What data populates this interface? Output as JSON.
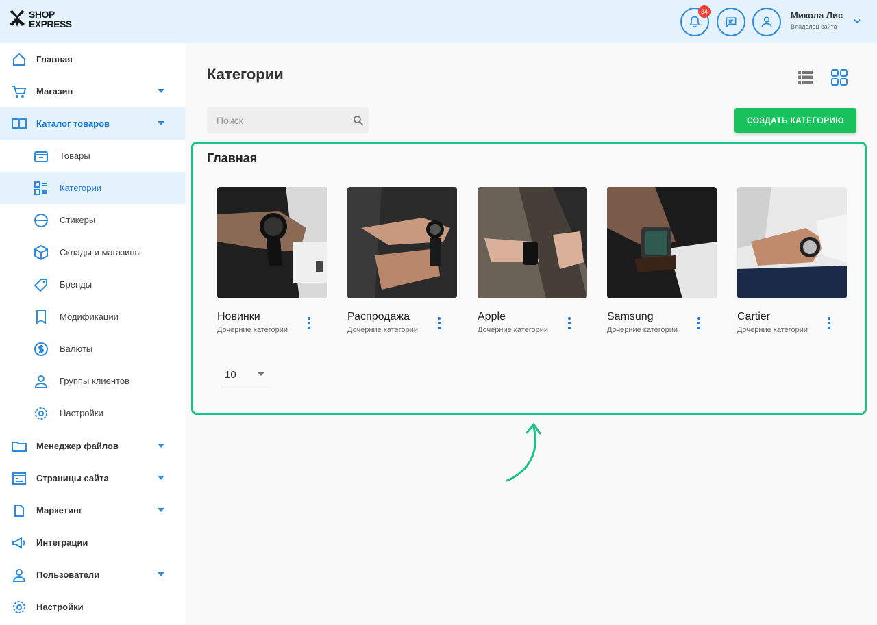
{
  "header": {
    "logo_line1": "SHOP",
    "logo_line2": "EXPRESS",
    "notifications_count": "34",
    "user_name": "Микола Лис",
    "user_role": "Владелец сайта"
  },
  "sidebar": {
    "items": [
      {
        "label": "Главная",
        "icon": "home-icon"
      },
      {
        "label": "Магазин",
        "icon": "cart-icon"
      },
      {
        "label": "Каталог товаров",
        "icon": "book-icon"
      },
      {
        "label": "Товары",
        "icon": "box-icon"
      },
      {
        "label": "Категории",
        "icon": "categories-icon"
      },
      {
        "label": "Стикеры",
        "icon": "sticker-icon"
      },
      {
        "label": "Склады и магазины",
        "icon": "warehouse-icon"
      },
      {
        "label": "Бренды",
        "icon": "tag-icon"
      },
      {
        "label": "Модификации",
        "icon": "bookmark-icon"
      },
      {
        "label": "Валюты",
        "icon": "dollar-icon"
      },
      {
        "label": "Группы клиентов",
        "icon": "users-icon"
      },
      {
        "label": "Настройки",
        "icon": "gear-icon"
      },
      {
        "label": "Менеджер файлов",
        "icon": "folder-icon"
      },
      {
        "label": "Страницы сайта",
        "icon": "pages-icon"
      },
      {
        "label": "Маркетинг",
        "icon": "marketing-icon"
      },
      {
        "label": "Интеграции",
        "icon": "megaphone-icon"
      },
      {
        "label": "Пользователи",
        "icon": "user-icon"
      },
      {
        "label": "Настройки",
        "icon": "gear-icon"
      }
    ]
  },
  "main": {
    "title": "Категории",
    "search_placeholder": "Поиск",
    "create_button": "СОЗДАТЬ КАТЕГОРИЮ",
    "group_title": "Главная",
    "categories": [
      {
        "name": "Новинки",
        "subtitle": "Дочерние категории"
      },
      {
        "name": "Распродажа",
        "subtitle": "Дочерние категории"
      },
      {
        "name": "Apple",
        "subtitle": "Дочерние категории"
      },
      {
        "name": "Samsung",
        "subtitle": "Дочерние категории"
      },
      {
        "name": "Cartier",
        "subtitle": "Дочерние категории"
      }
    ],
    "page_size": "10"
  },
  "colors": {
    "accent": "#1976d2",
    "header_bg": "#e3f2fd",
    "create_button_bg": "#18c25a",
    "highlight_border": "#1cc28b"
  }
}
